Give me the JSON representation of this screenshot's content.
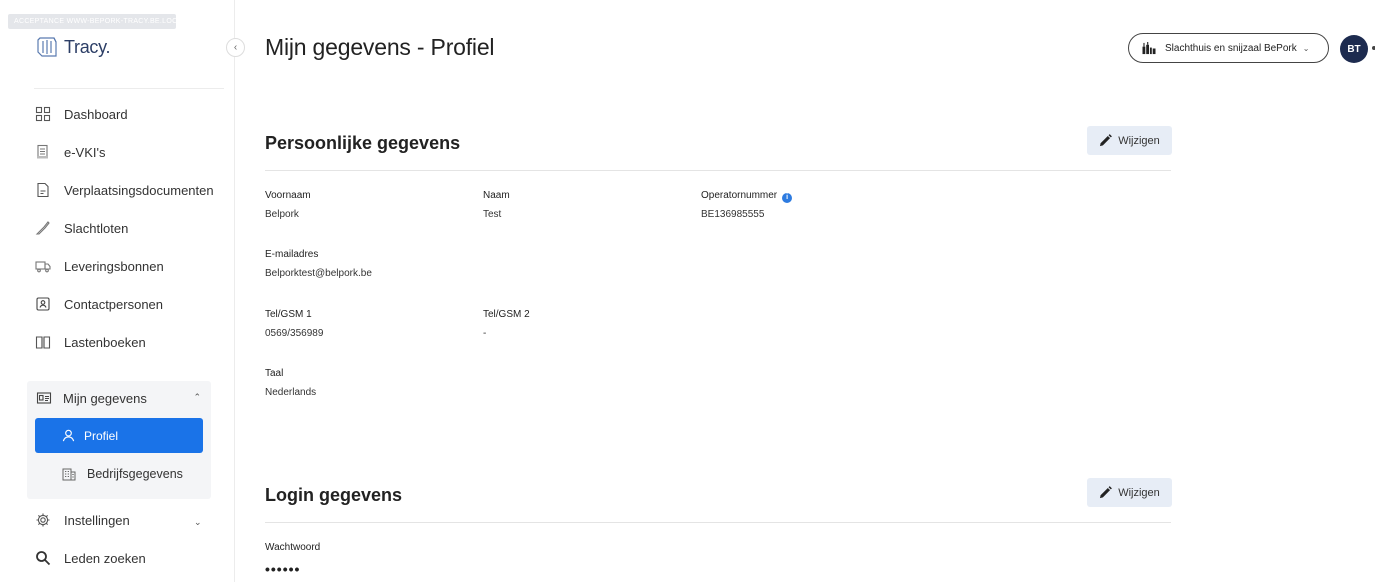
{
  "sidebar": {
    "env_badge": "ACCEPTANCE WWW-BEPORK-TRACY.BE.LOCAL",
    "logo_text": "Tracy.",
    "collapse_icon": "chevron-left-icon",
    "nav": [
      {
        "label": "Dashboard",
        "icon": "dashboard-icon"
      },
      {
        "label": "e-VKI's",
        "icon": "document-list-icon"
      },
      {
        "label": "Verplaatsingsdocumenten",
        "icon": "file-icon"
      },
      {
        "label": "Slachtloten",
        "icon": "knife-icon"
      },
      {
        "label": "Leveringsbonnen",
        "icon": "truck-icon"
      },
      {
        "label": "Contactpersonen",
        "icon": "contact-card-icon"
      },
      {
        "label": "Lastenboeken",
        "icon": "book-icon"
      }
    ],
    "group": {
      "label": "Mijn gegevens",
      "icon": "id-card-icon",
      "items": [
        {
          "label": "Profiel",
          "icon": "user-icon",
          "active": true
        },
        {
          "label": "Bedrijfsgegevens",
          "icon": "building-icon",
          "active": false
        }
      ]
    },
    "settings": {
      "label": "Instellingen",
      "icon": "gear-icon"
    },
    "search": {
      "label": "Leden zoeken",
      "icon": "search-icon"
    }
  },
  "header": {
    "title": "Mijn gegevens - Profiel",
    "org_select": {
      "value": "Slachthuis en snijzaal BePork",
      "icon": "factory-icon"
    },
    "avatar_initials": "BT"
  },
  "personal": {
    "title": "Persoonlijke gegevens",
    "edit_label": "Wijzigen",
    "fields": {
      "voornaam": {
        "label": "Voornaam",
        "value": "Belpork"
      },
      "naam": {
        "label": "Naam",
        "value": "Test"
      },
      "operator": {
        "label": "Operatornummer",
        "value": "BE136985555"
      },
      "email": {
        "label": "E-mailadres",
        "value": "Belporktest@belpork.be"
      },
      "tel1": {
        "label": "Tel/GSM 1",
        "value": "0569/356989"
      },
      "tel2": {
        "label": "Tel/GSM 2",
        "value": "-"
      },
      "taal": {
        "label": "Taal",
        "value": "Nederlands"
      }
    }
  },
  "login": {
    "title": "Login gegevens",
    "edit_label": "Wijzigen",
    "password_label": "Wachtwoord",
    "password_value": "••••••"
  },
  "colors": {
    "accent": "#1a73e8",
    "avatar": "#1d2b4f",
    "edit_bg": "#e7edf6"
  }
}
